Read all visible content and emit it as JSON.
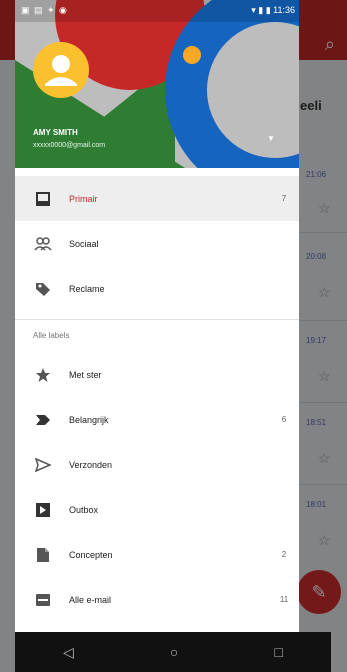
{
  "status_bar": {
    "left": "▣ ▤ ✦ ◉",
    "right": "▾ ▮ ▮ 11:36"
  },
  "account": {
    "name": "AMY SMITH",
    "email": "xxxxx0000@gmail.com"
  },
  "background": {
    "title": "eeli",
    "times": [
      "21:06",
      "20:08",
      "19:17",
      "18:51",
      "18:01"
    ]
  },
  "menu": {
    "primary": [
      {
        "label": "Primair",
        "count": "7",
        "icon": "inbox-icon",
        "selected": true
      },
      {
        "label": "Sociaal",
        "count": "",
        "icon": "people-icon",
        "selected": false
      },
      {
        "label": "Reclame",
        "count": "",
        "icon": "tag-icon",
        "selected": false
      }
    ],
    "section_label": "Alle labels",
    "labels": [
      {
        "label": "Met ster",
        "count": "",
        "icon": "star-icon"
      },
      {
        "label": "Belangrijk",
        "count": "6",
        "icon": "important-icon"
      },
      {
        "label": "Verzonden",
        "count": "",
        "icon": "send-icon"
      },
      {
        "label": "Outbox",
        "count": "",
        "icon": "outbox-icon"
      },
      {
        "label": "Concepten",
        "count": "2",
        "icon": "draft-icon"
      },
      {
        "label": "Alle e-mail",
        "count": "11",
        "icon": "all-mail-icon"
      }
    ]
  },
  "colors": {
    "accent": "#c62828",
    "header_green": "#2e7d32",
    "header_blue": "#1565c0",
    "avatar": "#fbc02d"
  }
}
